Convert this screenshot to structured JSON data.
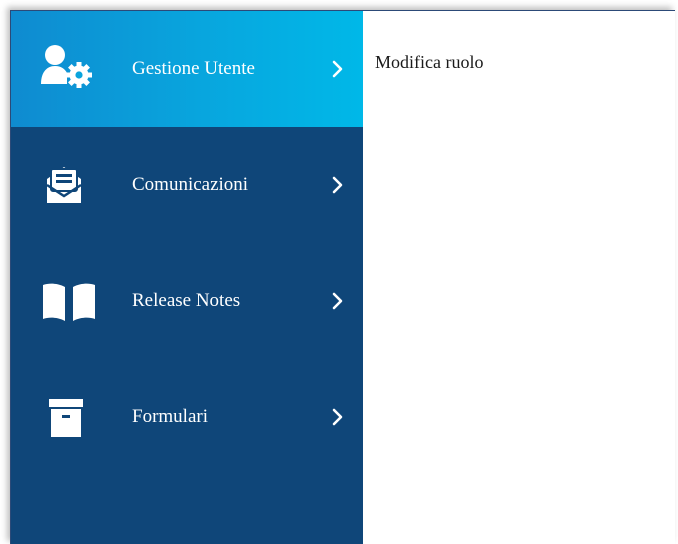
{
  "sidebar": {
    "colors": {
      "background": "#0f4679",
      "active_gradient_start": "#0f8bd0",
      "active_gradient_end": "#00b8e8",
      "text": "#ffffff"
    },
    "items": [
      {
        "label": "Gestione Utente",
        "icon": "user-gear-icon",
        "active": true
      },
      {
        "label": "Comunicazioni",
        "icon": "open-envelope-icon",
        "active": false
      },
      {
        "label": "Release Notes",
        "icon": "open-book-icon",
        "active": false
      },
      {
        "label": "Formulari",
        "icon": "archive-box-icon",
        "active": false
      }
    ],
    "chevron_icon": "chevron-right-icon"
  },
  "content": {
    "title": "Modifica ruolo"
  }
}
